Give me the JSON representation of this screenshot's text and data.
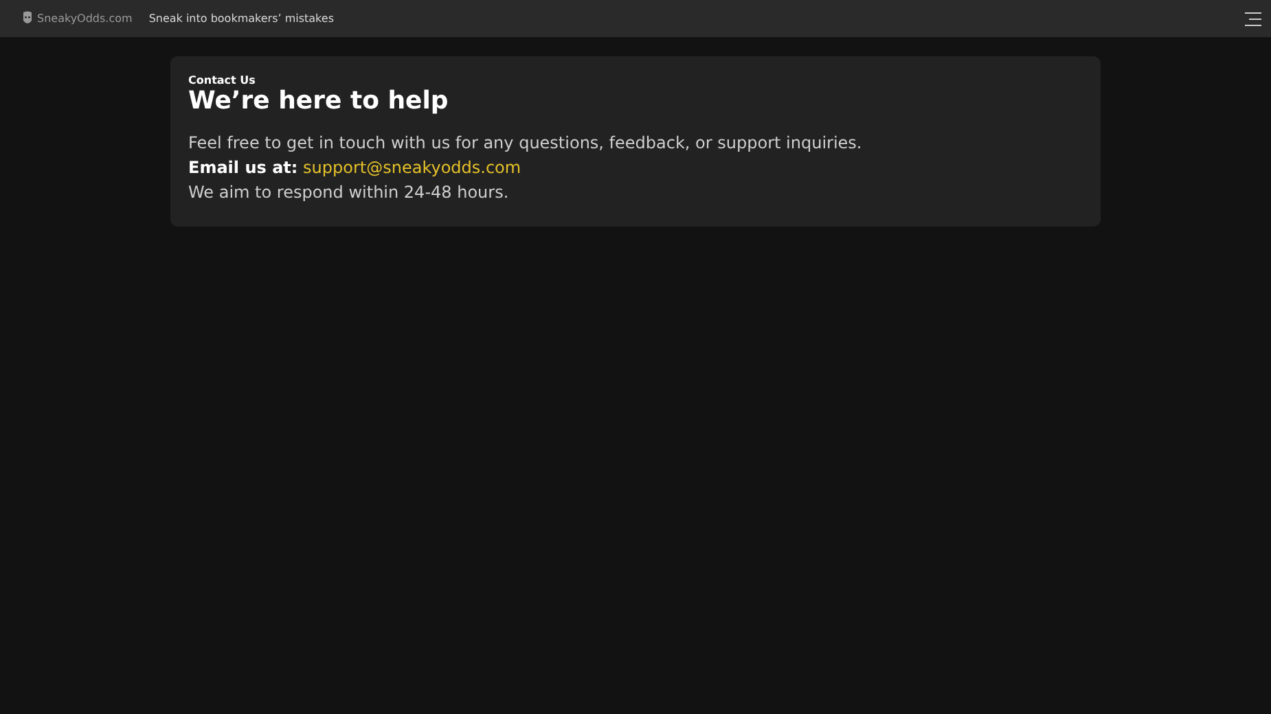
{
  "header": {
    "site_name": "SneakyOdds.com",
    "tagline": "Sneak into bookmakers’ mistakes"
  },
  "card": {
    "eyebrow": "Contact Us",
    "title": "We’re here to help",
    "intro": "Feel free to get in touch with us for any questions, feedback, or support inquiries.",
    "email_label": "Email us at:",
    "email": "support@sneakyodds.com",
    "note": "We aim to respond within 24-48 hours."
  }
}
